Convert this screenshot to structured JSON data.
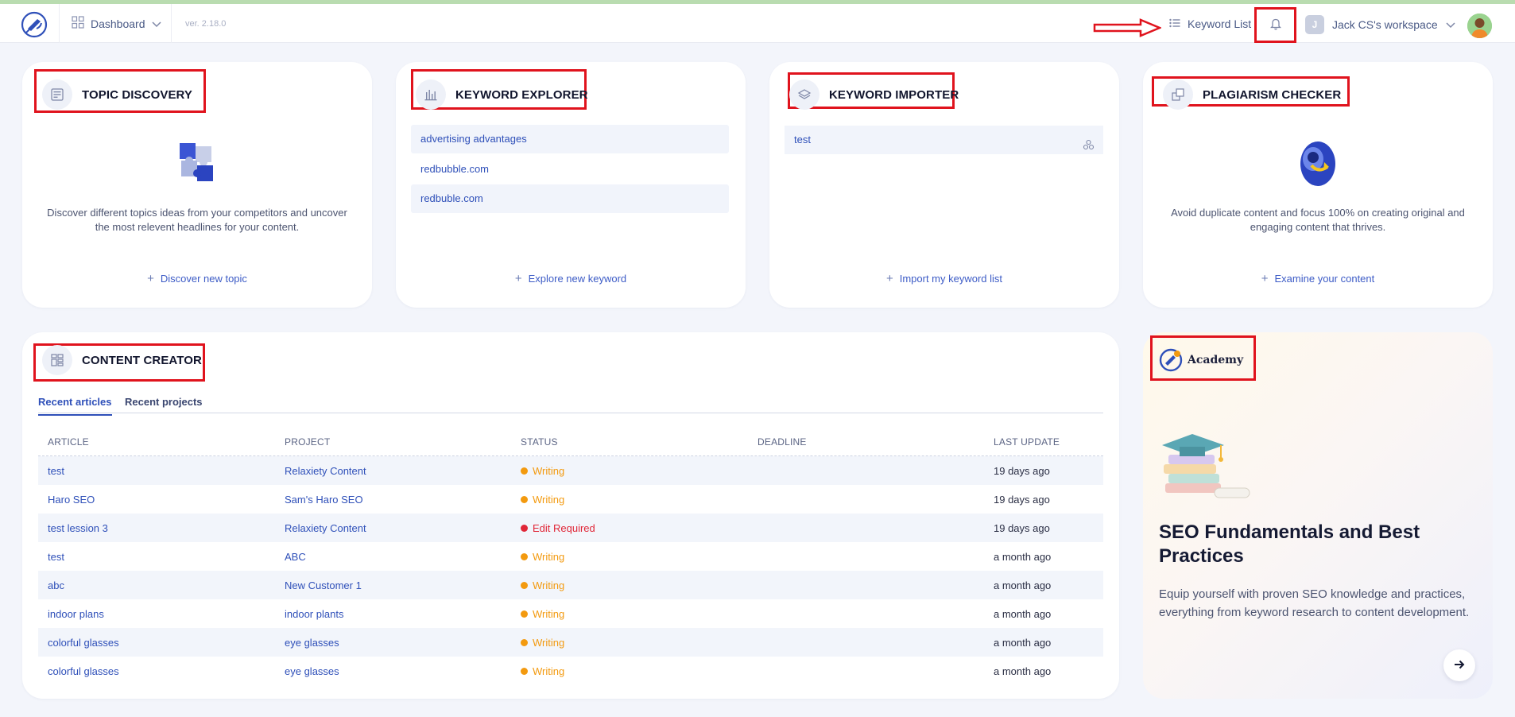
{
  "header": {
    "dashboard_label": "Dashboard",
    "version": "ver. 2.18.0",
    "keyword_list_label": "Keyword List",
    "workspace_initial": "J",
    "workspace_label": "Jack CS's workspace"
  },
  "topic_discovery": {
    "title": "TOPIC DISCOVERY",
    "description": "Discover different topics ideas from your competitors and uncover the most relevent headlines for your content.",
    "action": "Discover new topic"
  },
  "keyword_explorer": {
    "title": "KEYWORD EXPLORER",
    "items": [
      "advertising advantages",
      "redbubble.com",
      "redbuble.com"
    ],
    "action": "Explore new keyword"
  },
  "keyword_importer": {
    "title": "KEYWORD IMPORTER",
    "items": [
      "test"
    ],
    "action": "Import my keyword list"
  },
  "plagiarism_checker": {
    "title": "PLAGIARISM CHECKER",
    "description": "Avoid duplicate content and focus 100% on creating original and engaging content that thrives.",
    "action": "Examine your content"
  },
  "content_creator": {
    "title": "CONTENT CREATOR",
    "tabs": [
      "Recent articles",
      "Recent projects"
    ],
    "columns": [
      "ARTICLE",
      "PROJECT",
      "STATUS",
      "DEADLINE",
      "LAST UPDATE"
    ],
    "rows": [
      {
        "article": "test",
        "project": "Relaxiety Content",
        "status": "Writing",
        "deadline": "",
        "updated": "19 days ago"
      },
      {
        "article": "Haro SEO",
        "project": "Sam's Haro SEO",
        "status": "Writing",
        "deadline": "",
        "updated": "19 days ago"
      },
      {
        "article": "test lession 3",
        "project": "Relaxiety Content",
        "status": "Edit Required",
        "deadline": "",
        "updated": "19 days ago"
      },
      {
        "article": "test",
        "project": "ABC",
        "status": "Writing",
        "deadline": "",
        "updated": "a month ago"
      },
      {
        "article": "abc",
        "project": "New Customer 1",
        "status": "Writing",
        "deadline": "",
        "updated": "a month ago"
      },
      {
        "article": "indoor plans",
        "project": "indoor plants",
        "status": "Writing",
        "deadline": "",
        "updated": "a month ago"
      },
      {
        "article": "colorful glasses",
        "project": "eye glasses",
        "status": "Writing",
        "deadline": "",
        "updated": "a month ago"
      },
      {
        "article": "colorful glasses",
        "project": "eye glasses",
        "status": "Writing",
        "deadline": "",
        "updated": "a month ago"
      }
    ],
    "status_colors": {
      "Writing": "#f39a0f",
      "Edit Required": "#e02637"
    }
  },
  "academy": {
    "logo_text": "Academy",
    "title": "SEO Fundamentals and Best Practices",
    "description": "Equip yourself with proven SEO knowledge and practices, everything from keyword research to content development."
  },
  "colors": {
    "accent": "#2f50b9",
    "annotation": "#e0131d",
    "background": "#f3f5fb"
  }
}
